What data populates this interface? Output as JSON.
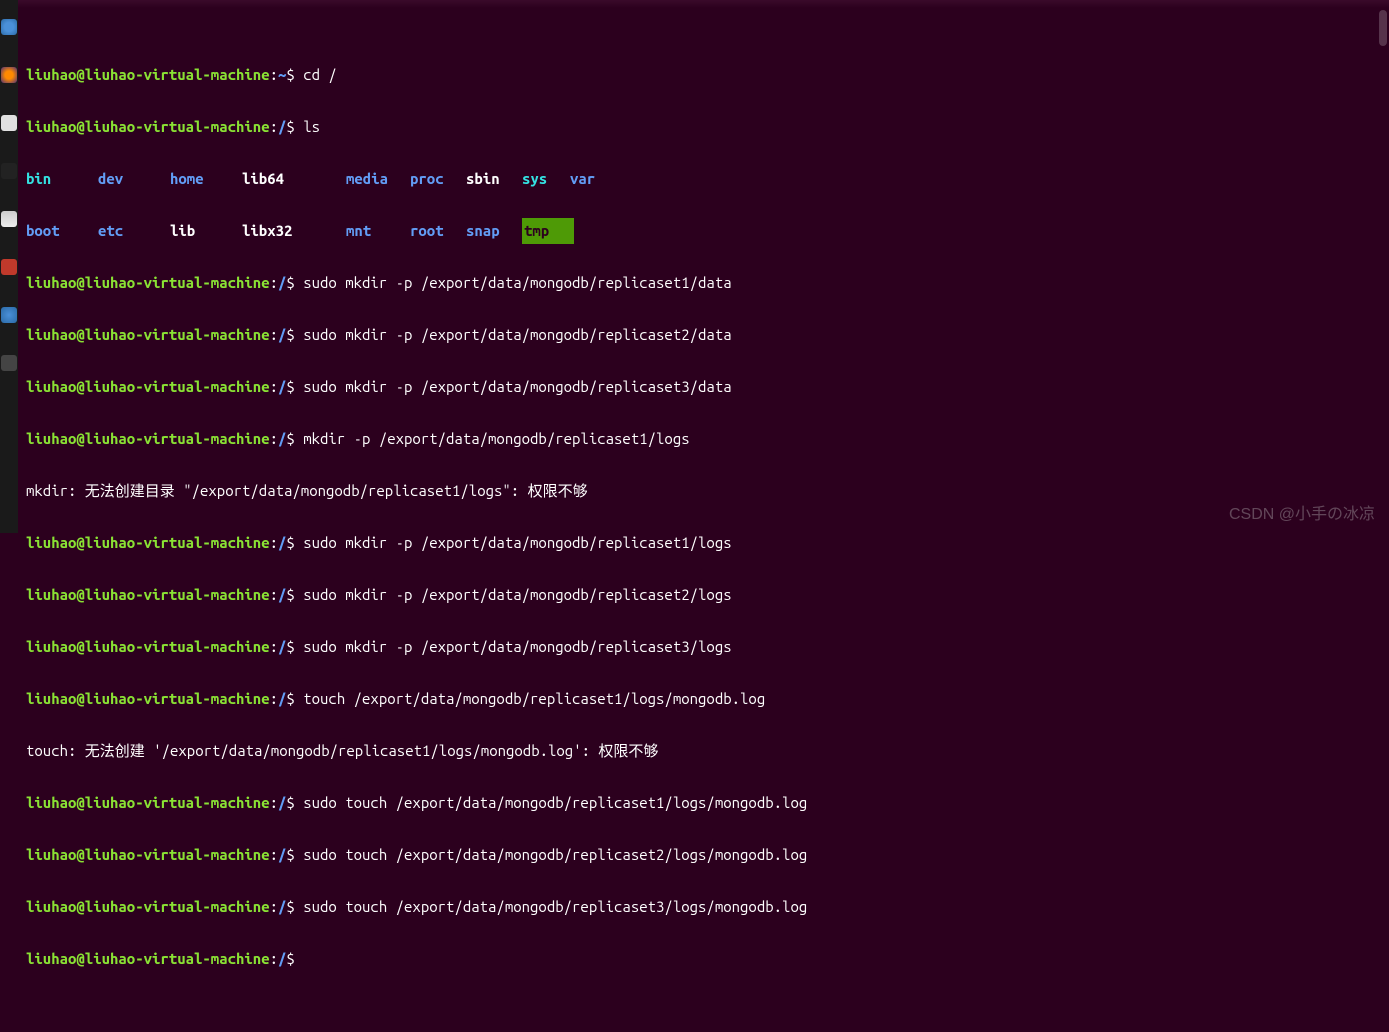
{
  "prompt": {
    "user": "liuhao@liuhao-virtual-machine",
    "sep": ":",
    "home_path": "~",
    "root_path": "/",
    "dollar": "$"
  },
  "lines": {
    "cd": "cd /",
    "ls": "ls",
    "mkdir1": "sudo mkdir -p /export/data/mongodb/replicaset1/data",
    "mkdir2": "sudo mkdir -p /export/data/mongodb/replicaset2/data",
    "mkdir3": "sudo mkdir -p /export/data/mongodb/replicaset3/data",
    "mkdir_fail": "mkdir -p /export/data/mongodb/replicaset1/logs",
    "mkdir_err": "mkdir: 无法创建目录 \"/export/data/mongodb/replicaset1/logs\": 权限不够",
    "mkdir_logs1": "sudo mkdir -p /export/data/mongodb/replicaset1/logs",
    "mkdir_logs2": "sudo mkdir -p /export/data/mongodb/replicaset2/logs",
    "mkdir_logs3": "sudo mkdir -p /export/data/mongodb/replicaset3/logs",
    "touch_fail": "touch /export/data/mongodb/replicaset1/logs/mongodb.log",
    "touch_err": "touch: 无法创建 '/export/data/mongodb/replicaset1/logs/mongodb.log': 权限不够",
    "touch1": "sudo touch /export/data/mongodb/replicaset1/logs/mongodb.log",
    "touch2": "sudo touch /export/data/mongodb/replicaset2/logs/mongodb.log",
    "touch3": "sudo touch /export/data/mongodb/replicaset3/logs/mongodb.log"
  },
  "ls": {
    "row1": [
      "bin",
      "dev",
      "home",
      "lib64",
      "media",
      "proc",
      "sbin",
      "sys",
      "var"
    ],
    "row2": [
      "boot",
      "etc",
      "lib",
      "libx32",
      "mnt",
      "root",
      "snap",
      "tmp"
    ]
  },
  "ls_classes": {
    "row1": [
      "cyan",
      "blue",
      "blue",
      "bold",
      "blue",
      "blue",
      "bold",
      "cyan",
      "blue"
    ],
    "row2": [
      "blue",
      "blue",
      "bold",
      "bold",
      "blue",
      "blue",
      "blue",
      "hl"
    ]
  },
  "watermark": "CSDN @小手の冰凉"
}
